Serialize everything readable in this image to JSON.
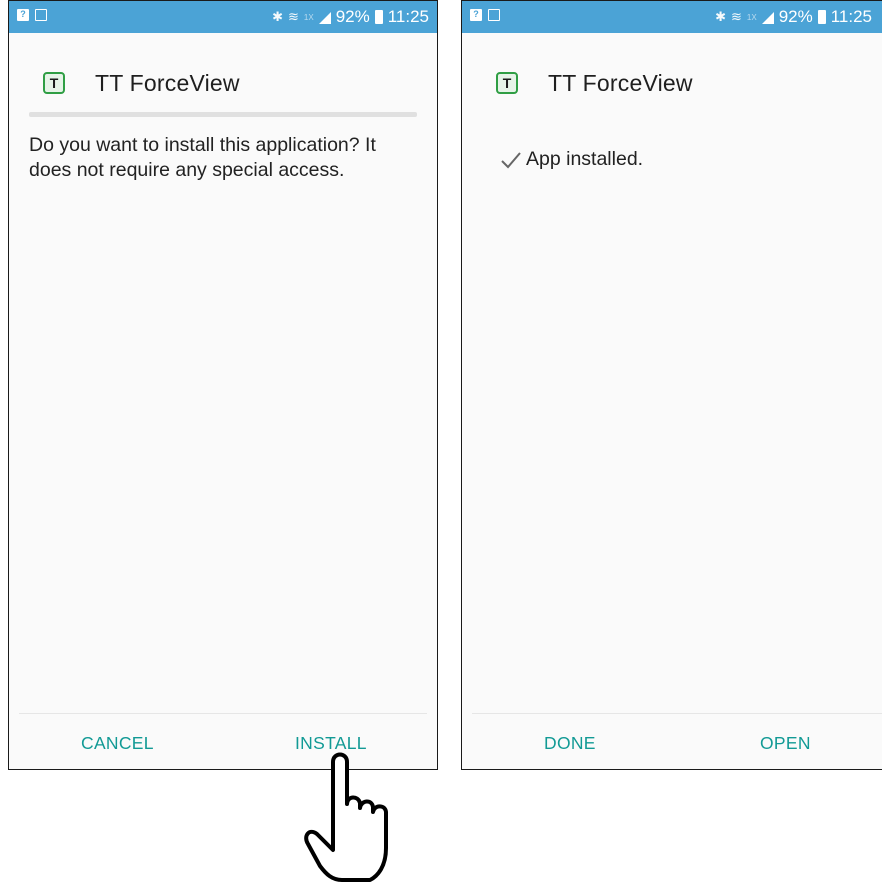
{
  "status_bar": {
    "battery": "92%",
    "time": "11:25",
    "net_small": "1X"
  },
  "left_screen": {
    "app_name": "TT ForceView",
    "message": "Do you want to install this application? It does not require any special access.",
    "buttons": {
      "cancel": "CANCEL",
      "install": "INSTALL"
    }
  },
  "right_screen": {
    "app_name": "TT ForceView",
    "status_message": "App installed.",
    "buttons": {
      "done": "DONE",
      "open": "OPEN"
    }
  },
  "colors": {
    "status_bar": "#4ba3d6",
    "accent": "#129a95",
    "app_icon": "#2f9e44"
  }
}
